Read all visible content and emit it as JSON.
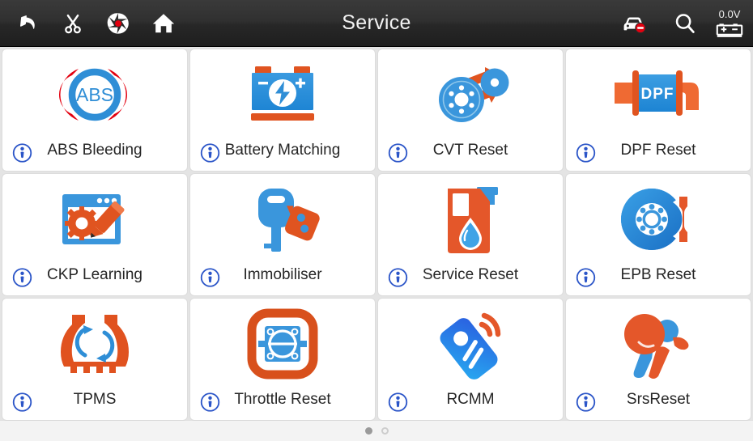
{
  "header": {
    "title": "Service",
    "left_buttons": [
      {
        "name": "back-button",
        "icon": "back-arrow-icon"
      },
      {
        "name": "snip-button",
        "icon": "scissors-icon"
      },
      {
        "name": "record-button",
        "icon": "camera-aperture-icon"
      },
      {
        "name": "home-button",
        "icon": "home-icon"
      }
    ],
    "right_buttons": [
      {
        "name": "vehicle-disconnected-button",
        "icon": "car-no-entry-icon"
      },
      {
        "name": "search-button",
        "icon": "search-icon"
      }
    ],
    "voltage": {
      "value": "0.0V",
      "icon": "battery-icon"
    }
  },
  "grid": {
    "info_icon_name": "info-icon",
    "tiles": [
      {
        "id": "abs-bleeding",
        "label": "ABS Bleeding",
        "icon": "abs-brake-icon"
      },
      {
        "id": "battery-matching",
        "label": "Battery Matching",
        "icon": "car-battery-icon"
      },
      {
        "id": "cvt-reset",
        "label": "CVT Reset",
        "icon": "cvt-pulley-belt-icon"
      },
      {
        "id": "dpf-reset",
        "label": "DPF Reset",
        "icon": "dpf-filter-icon"
      },
      {
        "id": "ckp-learning",
        "label": "CKP Learning",
        "icon": "gear-pencil-window-icon"
      },
      {
        "id": "immobiliser",
        "label": "Immobiliser",
        "icon": "key-fob-icon"
      },
      {
        "id": "service-reset",
        "label": "Service Reset",
        "icon": "oil-bottle-drop-icon"
      },
      {
        "id": "epb-reset",
        "label": "EPB Reset",
        "icon": "brake-disc-caliper-icon"
      },
      {
        "id": "tpms",
        "label": "TPMS",
        "icon": "tire-pressure-icon"
      },
      {
        "id": "throttle-reset",
        "label": "Throttle Reset",
        "icon": "throttle-body-icon"
      },
      {
        "id": "rcmm",
        "label": "RCMM",
        "icon": "remote-signal-icon"
      },
      {
        "id": "srs-reset",
        "label": "SrsReset",
        "icon": "airbag-occupant-icon"
      }
    ]
  },
  "footer": {
    "pages": [
      {
        "name": "page-dot-1",
        "active": true
      },
      {
        "name": "page-dot-2",
        "active": false
      }
    ]
  },
  "colors": {
    "blue": "#2f8ed6",
    "blue_dark": "#1a6fb5",
    "orange": "#e05420",
    "orange_light": "#f0622a",
    "red": "#e3000f",
    "header_bg": "#2b2b2b",
    "tile_bg": "#ffffff",
    "page_bg": "#e4e4e4",
    "label_text": "#262626"
  }
}
